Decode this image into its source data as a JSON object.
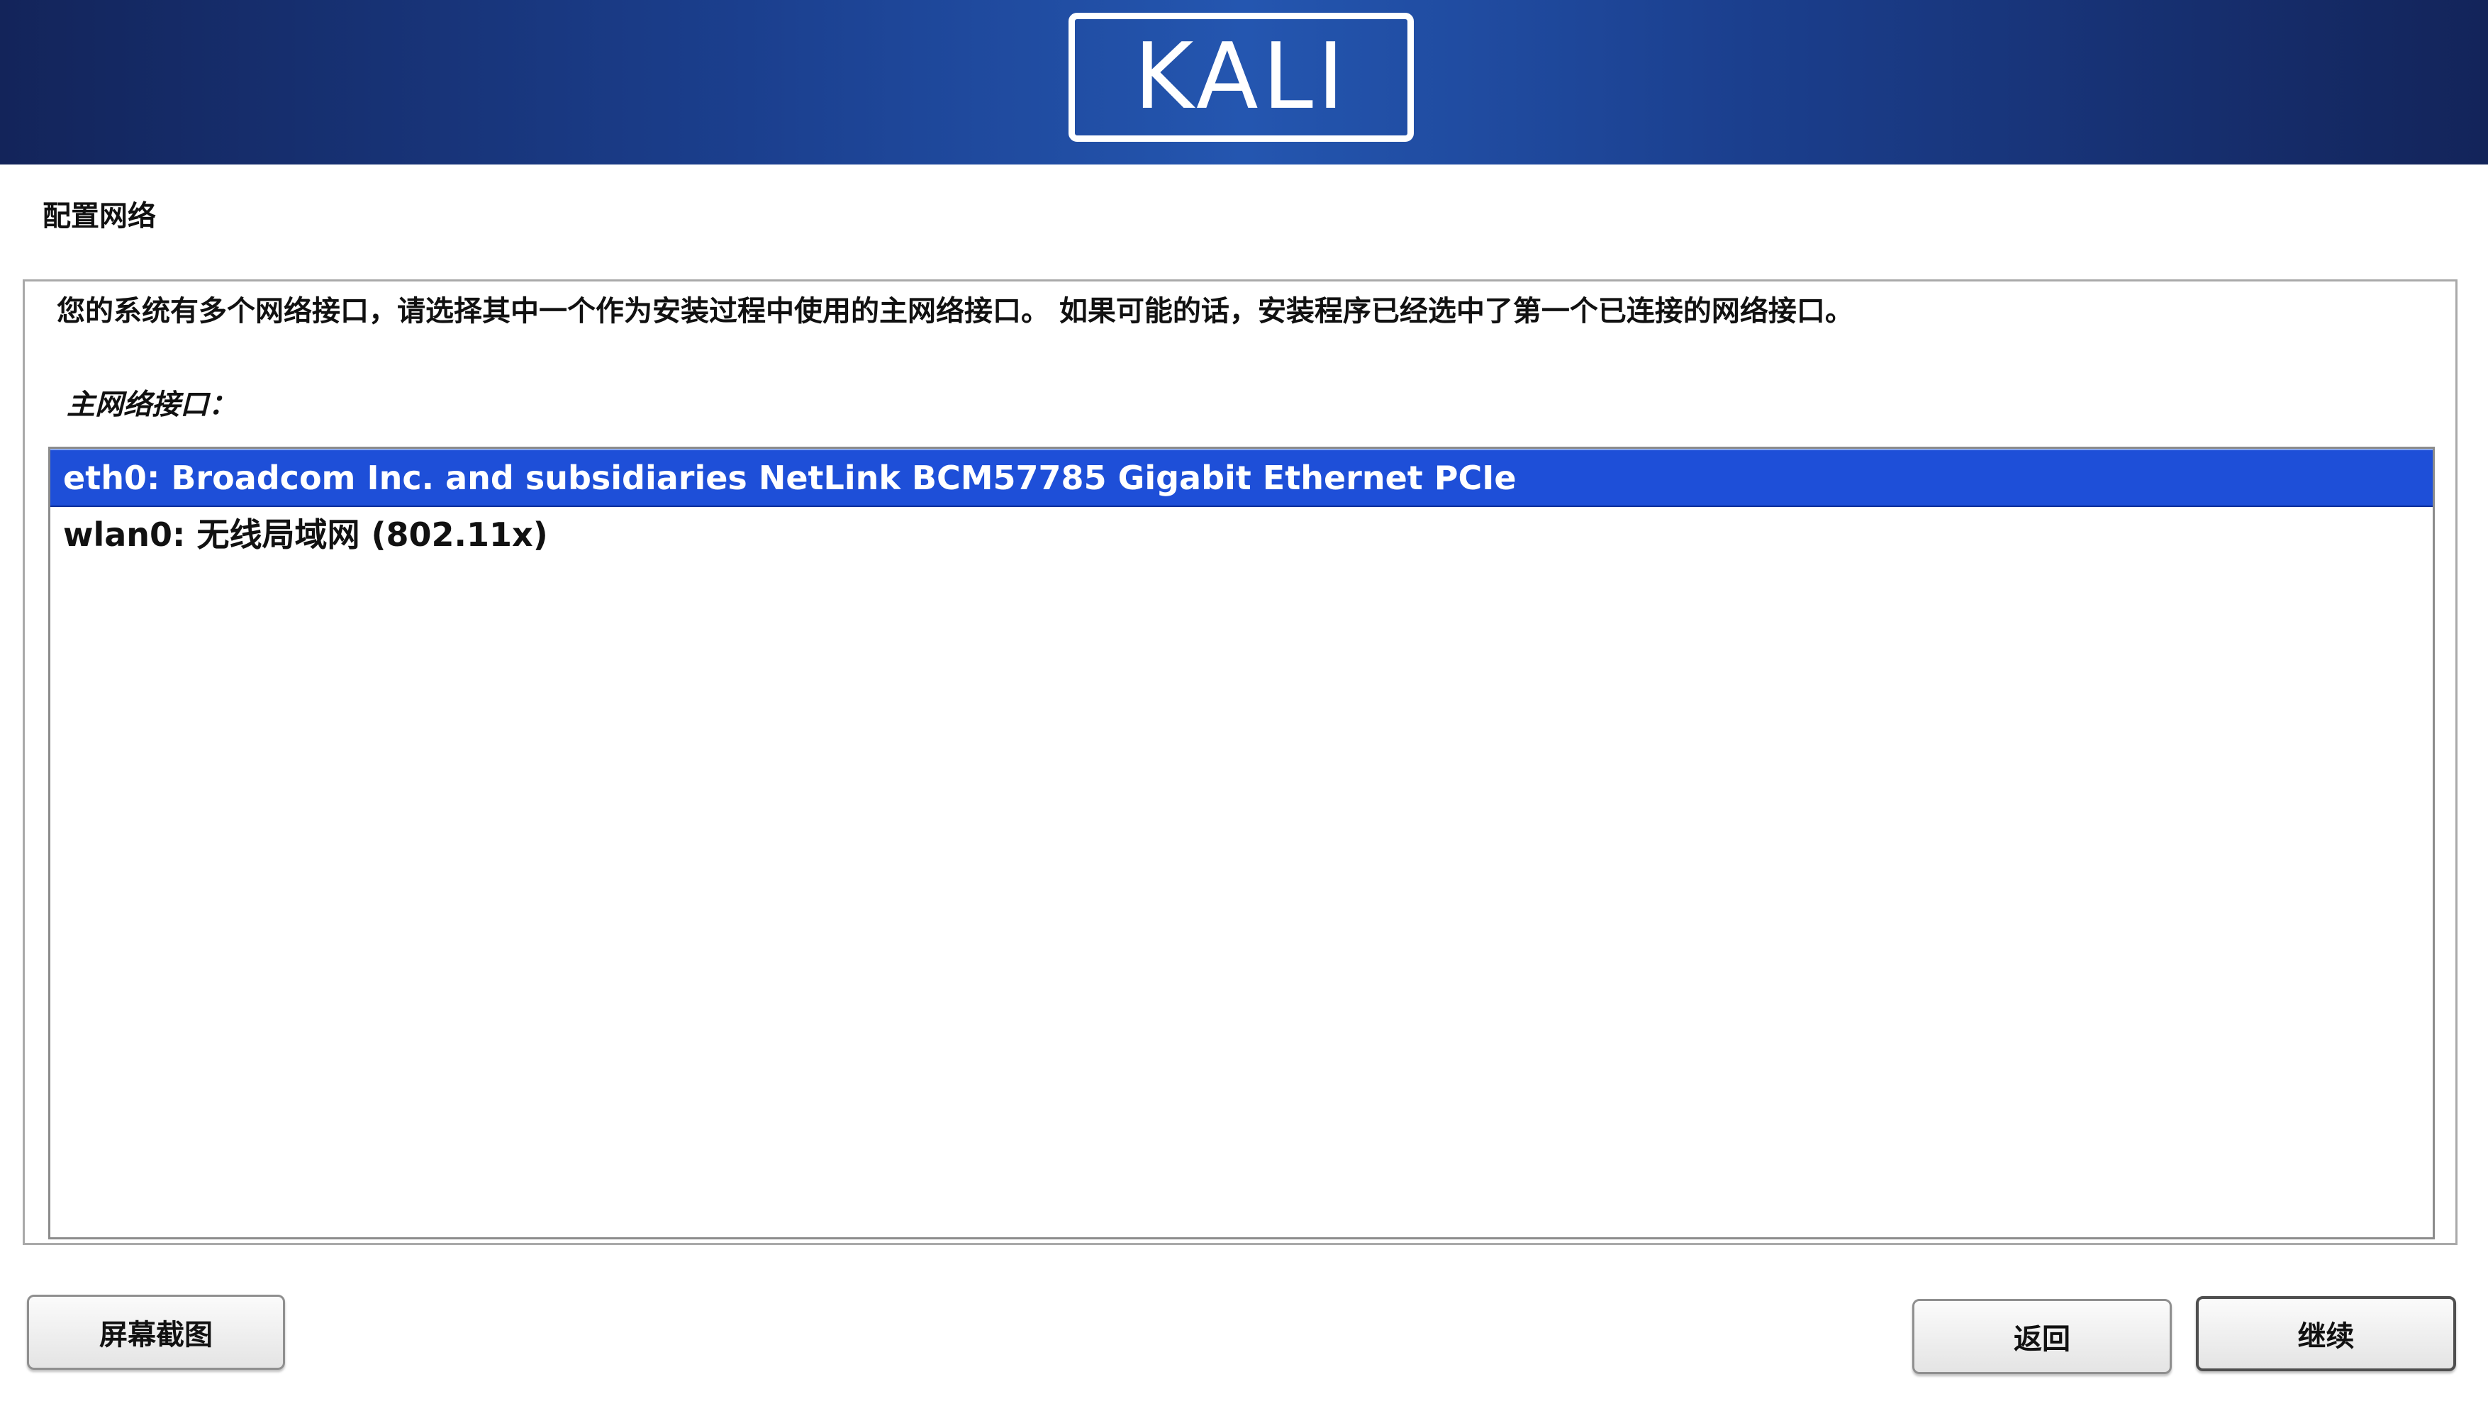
{
  "branding": {
    "logo_text": "KALI"
  },
  "page": {
    "title": "配置网络",
    "description": "您的系统有多个网络接口，请选择其中一个作为安装过程中使用的主网络接口。 如果可能的话，安装程序已经选中了第一个已连接的网络接口。",
    "list_label": "主网络接口："
  },
  "interfaces": [
    {
      "label": "eth0: Broadcom Inc. and subsidiaries NetLink BCM57785 Gigabit Ethernet PCIe",
      "selected": true
    },
    {
      "label": "wlan0: 无线局域网 (802.11x)",
      "selected": false
    }
  ],
  "buttons": {
    "screenshot": "屏幕截图",
    "back": "返回",
    "continue": "继续"
  },
  "colors": {
    "banner": "#1b3f8e",
    "selection": "#1e4fd8"
  }
}
